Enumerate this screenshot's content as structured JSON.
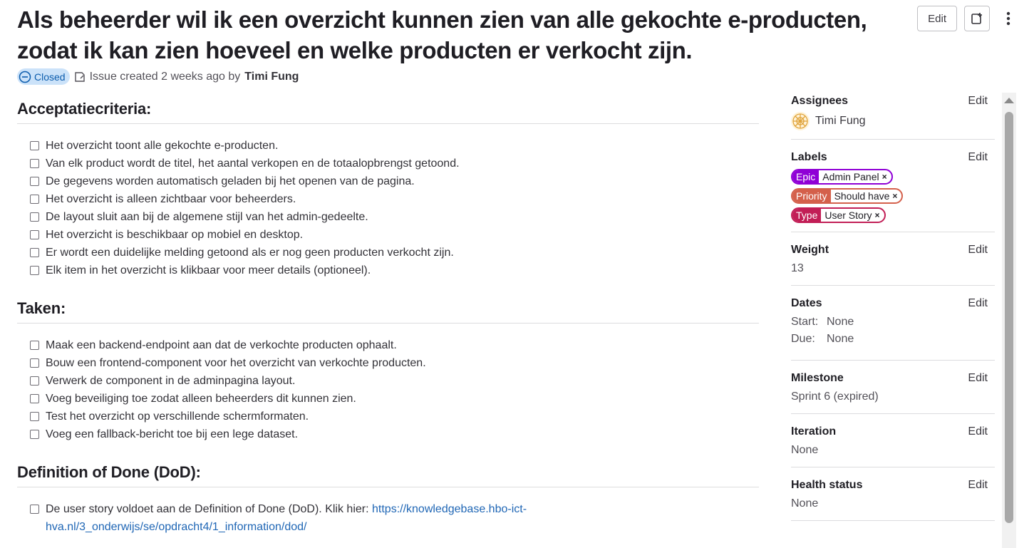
{
  "issue": {
    "title": "Als beheerder wil ik een overzicht kunnen zien van alle gekochte e-producten, zodat ik kan zien hoeveel en welke producten er verkocht zijn.",
    "status": "Closed",
    "created_text": "Issue created 2 weeks ago by",
    "author": "Timi Fung"
  },
  "header": {
    "edit_label": "Edit",
    "new_icon": "add-note-icon",
    "more_icon": "kebab-icon"
  },
  "sections": {
    "acceptance": {
      "heading": "Acceptatiecriteria:",
      "items": [
        "Het overzicht toont alle gekochte e-producten.",
        "Van elk product wordt de titel, het aantal verkopen en de totaalopbrengst getoond.",
        "De gegevens worden automatisch geladen bij het openen van de pagina.",
        "Het overzicht is alleen zichtbaar voor beheerders.",
        "De layout sluit aan bij de algemene stijl van het admin-gedeelte.",
        "Het overzicht is beschikbaar op mobiel en desktop.",
        "Er wordt een duidelijke melding getoond als er nog geen producten verkocht zijn.",
        "Elk item in het overzicht is klikbaar voor meer details (optioneel)."
      ]
    },
    "tasks": {
      "heading": "Taken:",
      "items": [
        "Maak een backend-endpoint aan dat de verkochte producten ophaalt.",
        "Bouw een frontend-component voor het overzicht van verkochte producten.",
        "Verwerk de component in de adminpagina layout.",
        "Voeg beveiliging toe zodat alleen beheerders dit kunnen zien.",
        "Test het overzicht op verschillende schermformaten.",
        "Voeg een fallback-bericht toe bij een lege dataset."
      ]
    },
    "dod": {
      "heading": "Definition of Done (DoD):",
      "text": "De user story voldoet aan de Definition of Done (DoD). Klik hier: ",
      "link_line1": "https://knowledgebase.hbo-ict-",
      "link_line2": "hva.nl/3_onderwijs/se/opdracht4/1_information/dod/"
    }
  },
  "sidebar": {
    "edit_label": "Edit",
    "assignees": {
      "title": "Assignees",
      "name": "Timi Fung"
    },
    "labels": {
      "title": "Labels",
      "items": [
        {
          "key": "Epic",
          "value": "Admin Panel",
          "color": "#8f00d6"
        },
        {
          "key": "Priority",
          "value": "Should have",
          "color": "#d4604b"
        },
        {
          "key": "Type",
          "value": "User Story",
          "color": "#c21e56"
        }
      ]
    },
    "weight": {
      "title": "Weight",
      "value": "13"
    },
    "dates": {
      "title": "Dates",
      "start_label": "Start:",
      "start": "None",
      "due_label": "Due:",
      "due": "None"
    },
    "milestone": {
      "title": "Milestone",
      "value": "Sprint 6 (expired)"
    },
    "iteration": {
      "title": "Iteration",
      "value": "None"
    },
    "health": {
      "title": "Health status",
      "value": "None"
    }
  },
  "colors": {
    "closed_badge_bg": "#cbe2f9",
    "closed_badge_text": "#0b5cad",
    "link": "#1f66b5"
  }
}
